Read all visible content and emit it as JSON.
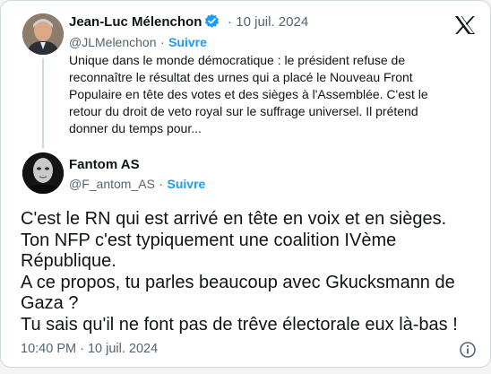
{
  "quoted": {
    "author_name": "Jean-Luc Mélenchon",
    "date": "10 juil. 2024",
    "handle": "@JLMelenchon",
    "follow_label": "Suivre",
    "text": "Unique dans le monde démocratique : le président refuse de reconnaître le résultat des urnes qui a placé le Nouveau Front Populaire en tête des votes et des sièges à l'Assemblée. C'est le retour du droit de veto royal sur le suffrage universel. Il prétend donner du temps pour..."
  },
  "reply": {
    "author_name": "Fantom AS",
    "handle": "@F_antom_AS",
    "follow_label": "Suivre",
    "text_lines": [
      "C'est le RN qui est arrivé en tête en voix et en sièges.",
      "Ton NFP c'est typiquement une coalition IVème",
      "République.",
      "A ce propos, tu parles beaucoup avec Gkucksmann de",
      "Gaza ?",
      "Tu sais qu'il ne font pas de trêve électorale eux là-bas !"
    ],
    "timestamp": "10:40 PM · 10 juil. 2024"
  },
  "separator": "·",
  "icons": [
    "x-logo-icon",
    "verified-badge-icon",
    "info-icon"
  ],
  "colors": {
    "text": "#0f1419",
    "secondary": "#536471",
    "accent": "#1d9bf0",
    "border": "#cfd9de"
  }
}
